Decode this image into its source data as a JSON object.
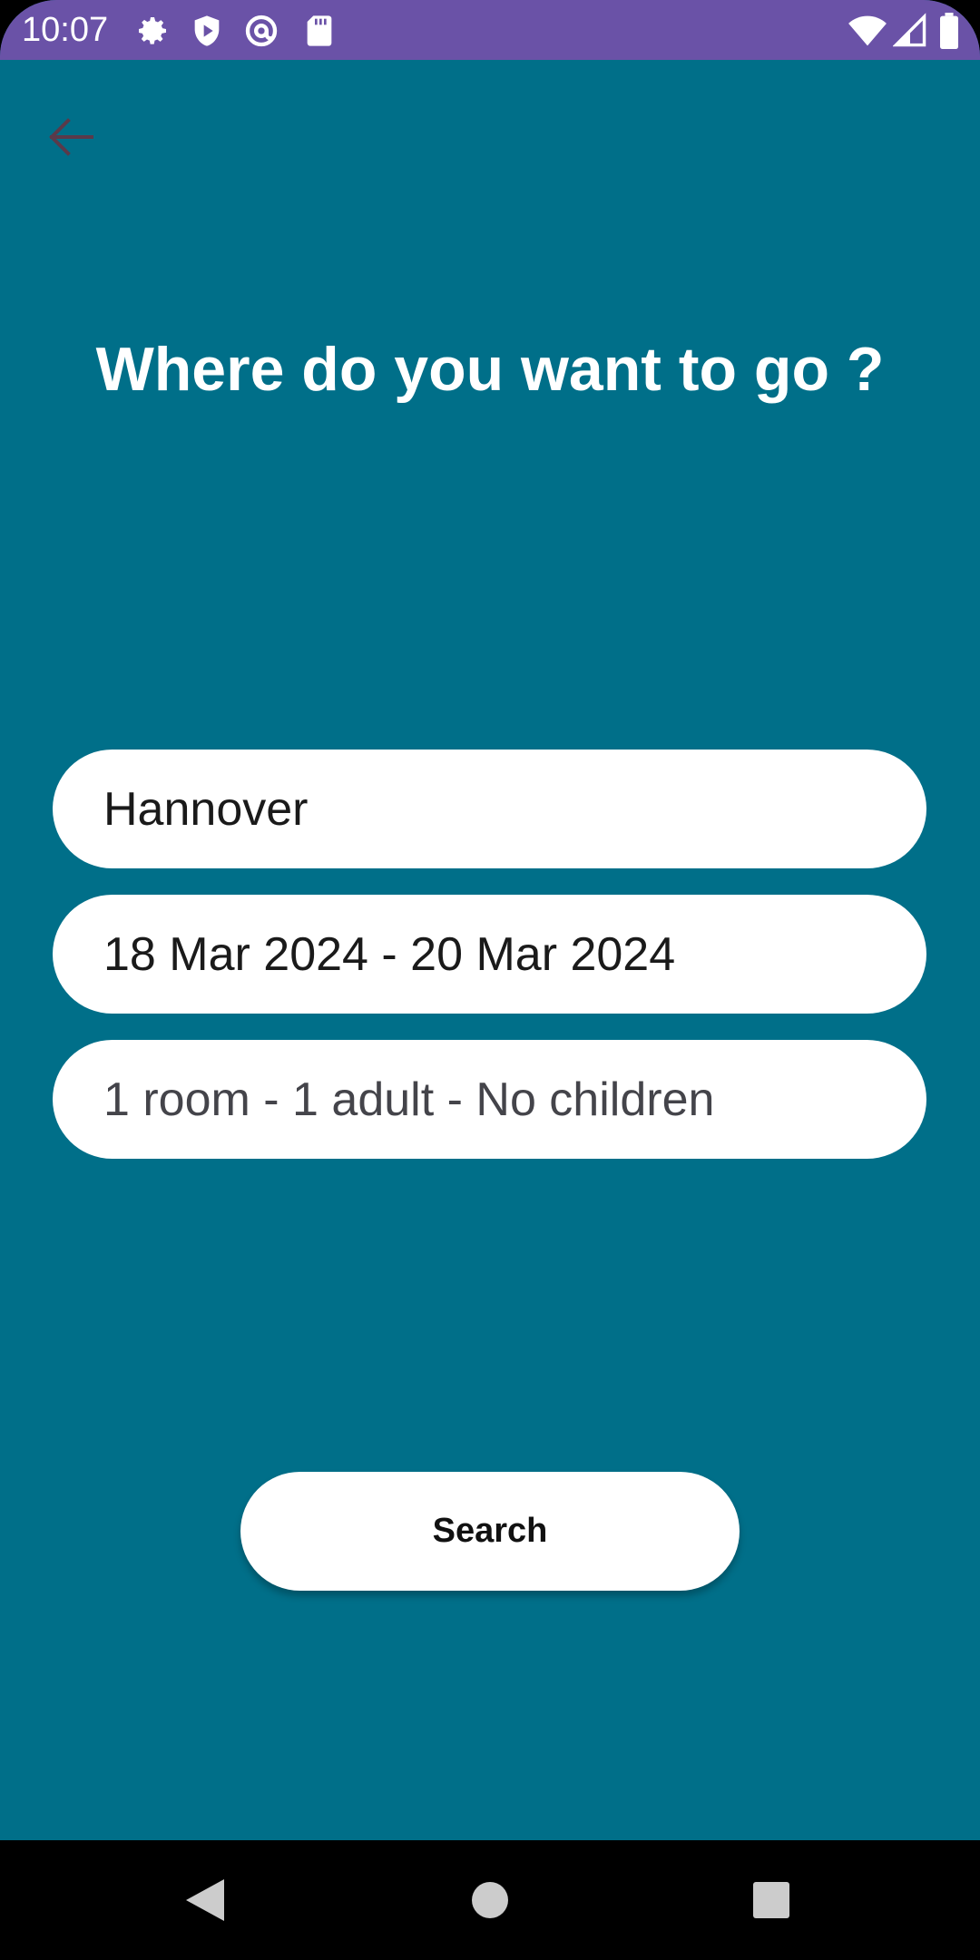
{
  "status_bar": {
    "time": "10:07",
    "left_icons": [
      "settings-icon",
      "shield-play-icon",
      "at-sign-icon",
      "sd-card-icon"
    ],
    "right_icons": [
      "wifi-icon",
      "signal-icon",
      "battery-icon"
    ]
  },
  "header": {
    "back_icon": "arrow-left-icon"
  },
  "main": {
    "title": "Where do you want to go ?",
    "destination_value": "Hannover",
    "dates_value": "18 Mar 2024 - 20 Mar 2024",
    "guests_value": "1 room - 1 adult - No children",
    "search_label": "Search"
  },
  "nav_bar": {
    "buttons": [
      "back-triangle-icon",
      "home-circle-icon",
      "recents-square-icon"
    ]
  },
  "colors": {
    "status_bar": "#6a52a7",
    "background": "#006f89",
    "field_bg": "#ffffff",
    "nav_bar": "#000000"
  }
}
